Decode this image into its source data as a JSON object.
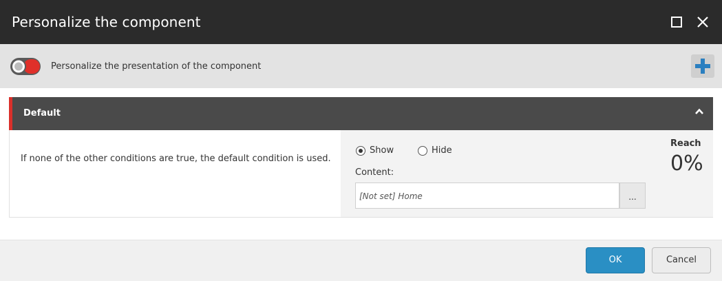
{
  "dialog": {
    "title": "Personalize the component",
    "maximize_icon": "maximize-icon",
    "close_icon": "close-icon"
  },
  "personalize": {
    "toggle_label": "Personalize the presentation of the component",
    "toggle_state": "off",
    "add_icon": "plus-icon",
    "add_color": "#2a7fc0"
  },
  "condition": {
    "title": "Default",
    "accent_color": "#d9302b",
    "collapse_icon": "chevron-up-icon",
    "description": "If none of the other conditions are true, the default condition is used.",
    "show_label": "Show",
    "hide_label": "Hide",
    "selected": "Show",
    "content_label": "Content:",
    "content_value": "[Not set] Home",
    "browse_label": "...",
    "reach_label": "Reach",
    "reach_value": "0%"
  },
  "footer": {
    "ok_label": "OK",
    "cancel_label": "Cancel",
    "ok_color": "#2a8fc4"
  }
}
